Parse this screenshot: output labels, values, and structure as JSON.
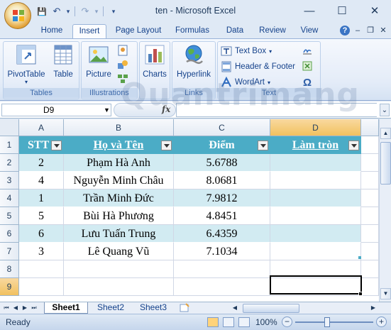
{
  "window": {
    "title": "ten - Microsoft Excel",
    "minimize": "—",
    "maximize": "☐",
    "close": "✕"
  },
  "qat": {
    "save": "💾",
    "undo": "↶",
    "undo_caret": "▾",
    "redo": "↷",
    "redo_caret": "▾",
    "customize": "▾"
  },
  "tabs": [
    {
      "label": "Home"
    },
    {
      "label": "Insert"
    },
    {
      "label": "Page Layout"
    },
    {
      "label": "Formulas"
    },
    {
      "label": "Data"
    },
    {
      "label": "Review"
    },
    {
      "label": "View"
    }
  ],
  "ribbon_controls": {
    "help": "?",
    "min": "–",
    "restore": "❐",
    "close": "✕"
  },
  "ribbon": {
    "tables": {
      "label": "Tables",
      "pivot": "PivotTable",
      "table": "Table"
    },
    "illustrations": {
      "label": "Illustrations",
      "picture": "Picture"
    },
    "charts": {
      "label": "Charts"
    },
    "links": {
      "label": "Links",
      "hyperlink": "Hyperlink"
    },
    "text": {
      "label": "Text",
      "textbox": "Text Box",
      "header_footer": "Header & Footer",
      "wordart": "WordArt",
      "omega": "Ω"
    }
  },
  "formula_bar": {
    "name_box": "D9",
    "fx": "fx",
    "formula": ""
  },
  "columns": [
    "A",
    "B",
    "C",
    "D"
  ],
  "rows": [
    "1",
    "2",
    "3",
    "4",
    "5",
    "6",
    "7",
    "8",
    "9"
  ],
  "table": {
    "headers": [
      "STT",
      "Họ và Tên",
      "Điểm",
      "Làm tròn"
    ],
    "rows": [
      [
        "2",
        "Phạm Hà Anh",
        "5.6788",
        ""
      ],
      [
        "4",
        "Nguyễn Minh Châu",
        "8.0681",
        ""
      ],
      [
        "1",
        "Trần Minh Đức",
        "7.9812",
        ""
      ],
      [
        "5",
        "Bùi Hà Phương",
        "4.8451",
        ""
      ],
      [
        "6",
        "Lưu Tuấn Trung",
        "6.4359",
        ""
      ],
      [
        "3",
        "Lê Quang Vũ",
        "7.1034",
        ""
      ]
    ]
  },
  "sheet_tabs": [
    "Sheet1",
    "Sheet2",
    "Sheet3"
  ],
  "nav_arrows": [
    "⏮",
    "◀",
    "▶",
    "⏭"
  ],
  "status": {
    "text": "Ready",
    "zoom": "100%",
    "zoom_minus": "−",
    "zoom_plus": "+",
    "zoom_level_percent": 100
  },
  "scroll": {
    "up": "▲",
    "down": "▼"
  },
  "watermark": "Quantrimang",
  "colors": {
    "header_fill": "#4bacc6",
    "band_fill": "#d2ebf2",
    "selected_header": "#f1c15f"
  }
}
